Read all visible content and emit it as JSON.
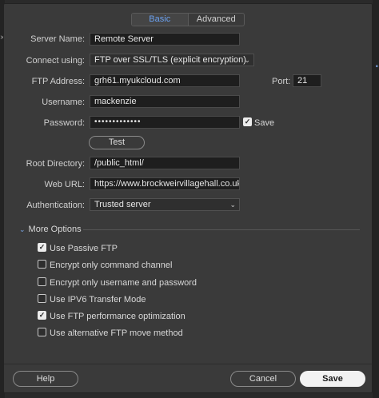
{
  "tabs": [
    {
      "label": "Basic"
    },
    {
      "label": "Advanced"
    }
  ],
  "form": {
    "server_name": {
      "label": "Server Name:",
      "value": "Remote Server"
    },
    "connect_using": {
      "label": "Connect using:",
      "value": "FTP over SSL/TLS (explicit encryption)"
    },
    "ftp_address": {
      "label": "FTP Address:",
      "value": "grh61.myukcloud.com"
    },
    "port": {
      "label": "Port:",
      "value": "21"
    },
    "username": {
      "label": "Username:",
      "value": "mackenzie"
    },
    "password": {
      "label": "Password:",
      "value": "•••••••••••••"
    },
    "save_password": {
      "label": "Save",
      "checked": true
    },
    "test_button": "Test",
    "root_directory": {
      "label": "Root Directory:",
      "value": "/public_html/"
    },
    "web_url": {
      "label": "Web URL:",
      "value": "https://www.brockweirvillagehall.co.uk"
    },
    "authentication": {
      "label": "Authentication:",
      "value": "Trusted server"
    }
  },
  "more_options": {
    "title": "More Options",
    "items": [
      {
        "label": "Use Passive FTP",
        "checked": true
      },
      {
        "label": "Encrypt only command channel",
        "checked": false
      },
      {
        "label": "Encrypt only username and password",
        "checked": false
      },
      {
        "label": "Use IPV6 Transfer Mode",
        "checked": false
      },
      {
        "label": "Use FTP performance optimization",
        "checked": true
      },
      {
        "label": "Use alternative FTP move method",
        "checked": false
      }
    ]
  },
  "footer": {
    "help": "Help",
    "cancel": "Cancel",
    "save": "Save"
  },
  "icons": {
    "dropdown": "chevron-down-icon",
    "section": "chevron-down-icon",
    "checkmark": "checkmark-icon"
  },
  "colors": {
    "accent": "#6aa0ef",
    "background": "#3a3a3a",
    "field": "#1e1e1e"
  }
}
